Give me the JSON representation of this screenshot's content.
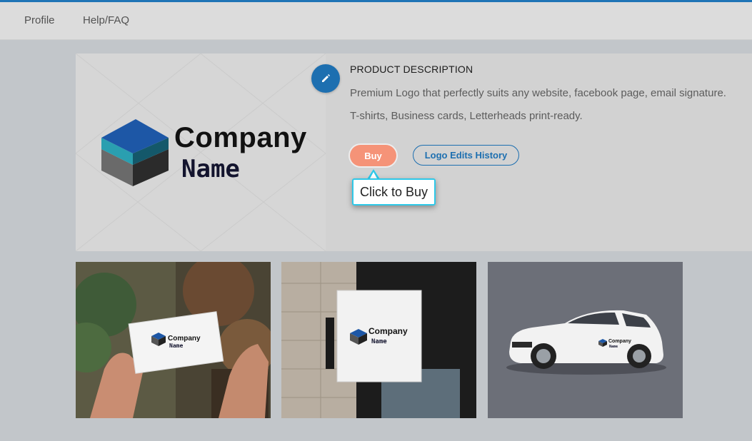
{
  "nav": {
    "items": [
      "Profile",
      "Help/FAQ"
    ]
  },
  "logo": {
    "company": "Company",
    "name": "Name"
  },
  "product": {
    "heading": "PRODUCT DESCRIPTION",
    "line1": "Premium Logo that perfectly suits any website, facebook page, email signature.",
    "line2": "T-shirts, Business cards, Letterheads print-ready."
  },
  "buttons": {
    "buy": "Buy",
    "history": "Logo Edits History"
  },
  "tooltip": {
    "text": "Click to Buy"
  },
  "mockups": {
    "card": {
      "company": "Company",
      "name": "Name"
    },
    "sign": {
      "company": "Company",
      "name": "Name"
    },
    "car": {
      "company": "Company",
      "name": "Name"
    }
  },
  "colors": {
    "accent": "#1d6fb0",
    "buy": "#f59378",
    "tooltip_border": "#2ec8e8"
  }
}
